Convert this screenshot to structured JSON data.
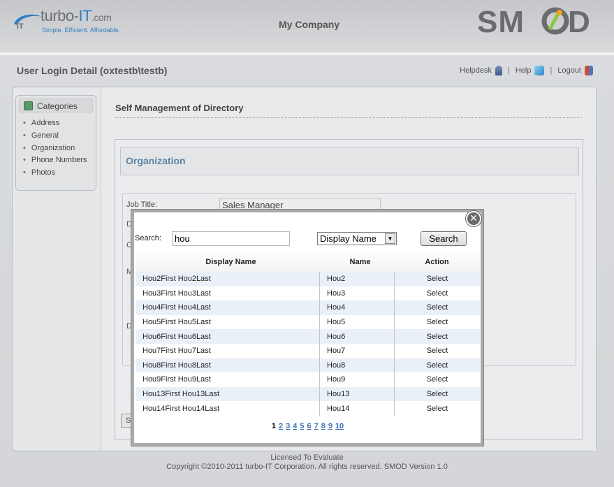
{
  "header": {
    "logo_brand": "turbo-",
    "logo_it": "IT",
    "logo_domain": ".com",
    "logo_tagline": "Simple. Efficient. Affordable.",
    "company": "My Company",
    "product_logo": "SMOD"
  },
  "subheader": {
    "title": "User Login Detail (oxtestb\\testb)",
    "links": {
      "helpdesk": "Helpdesk",
      "help": "Help",
      "logout": "Logout"
    },
    "separator": "|"
  },
  "sidebar": {
    "heading": "Categories",
    "items": [
      "Address",
      "General",
      "Organization",
      "Phone Numbers",
      "Photos"
    ]
  },
  "main": {
    "title": "Self Management of Directory",
    "section_title": "Organization",
    "job_title_label": "Job Title:",
    "job_title_value": "Sales Manager",
    "peek_labels": [
      "D",
      "C",
      "M",
      "D",
      "S"
    ]
  },
  "modal": {
    "close_symbol": "✕",
    "search_label": "Search:",
    "search_value": "hou",
    "search_field_selected": "Display Name",
    "search_button": "Search",
    "columns": [
      "Display Name",
      "Name",
      "Action"
    ],
    "rows": [
      {
        "display": "Hou2First Hou2Last",
        "name": "Hou2",
        "action": "Select"
      },
      {
        "display": "Hou3First Hou3Last",
        "name": "Hou3",
        "action": "Select"
      },
      {
        "display": "Hou4First Hou4Last",
        "name": "Hou4",
        "action": "Select"
      },
      {
        "display": "Hou5First Hou5Last",
        "name": "Hou5",
        "action": "Select"
      },
      {
        "display": "Hou6First Hou6Last",
        "name": "Hou6",
        "action": "Select"
      },
      {
        "display": "Hou7First Hou7Last",
        "name": "Hou7",
        "action": "Select"
      },
      {
        "display": "Hou8First Hou8Last",
        "name": "Hou8",
        "action": "Select"
      },
      {
        "display": "Hou9First Hou9Last",
        "name": "Hou9",
        "action": "Select"
      },
      {
        "display": "Hou13First Hou13Last",
        "name": "Hou13",
        "action": "Select"
      },
      {
        "display": "Hou14First Hou14Last",
        "name": "Hou14",
        "action": "Select"
      }
    ],
    "pages": [
      "1",
      "2",
      "3",
      "4",
      "5",
      "6",
      "7",
      "8",
      "9",
      "10"
    ],
    "current_page": "1"
  },
  "footer": {
    "license": "Licensed To Evaluate",
    "copyright": "Copyright ©2010-2011 turbo-IT Corporation. All rights reserved. SMOD Version 1.0"
  },
  "colors": {
    "accent_blue": "#2f7fc1",
    "section_title": "#5a86a8",
    "link_blue": "#3a6fb5",
    "row_alt": "#eaf0f8"
  }
}
